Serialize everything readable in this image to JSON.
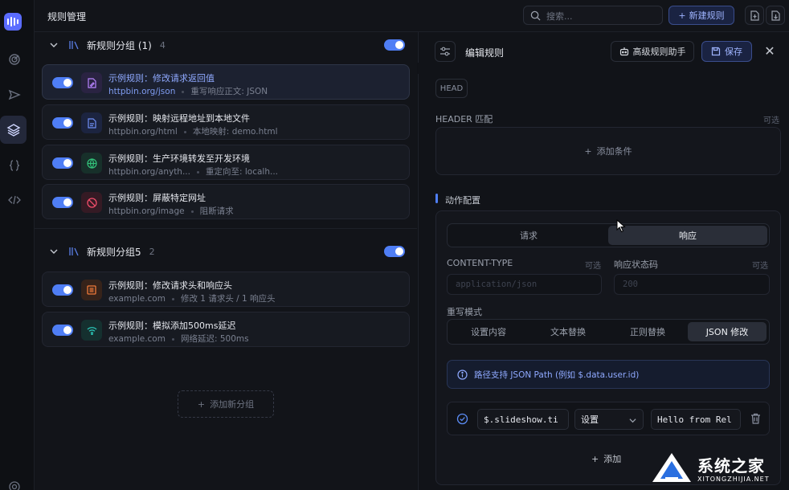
{
  "app": {
    "title": "规则管理"
  },
  "topbar": {
    "search_placeholder": "搜索...",
    "new_rule_label": "新建规则"
  },
  "groups": [
    {
      "title": "新规则分组 (1)",
      "count": "4",
      "enabled": true,
      "rules": [
        {
          "name": "示例规则：修改请求返回值",
          "host": "httpbin.org/json",
          "desc": "重写响应正文: JSON",
          "enabled": true,
          "icon": "edit-file-icon",
          "selected": true
        },
        {
          "name": "示例规则：映射远程地址到本地文件",
          "host": "httpbin.org/html",
          "desc": "本地映射: demo.html",
          "enabled": true,
          "icon": "file-icon"
        },
        {
          "name": "示例规则：生产环境转发至开发环境",
          "host": "httpbin.org/anyth...",
          "desc": "重定向至: localh...",
          "enabled": true,
          "icon": "globe-icon"
        },
        {
          "name": "示例规则：屏蔽特定网址",
          "host": "httpbin.org/image",
          "desc": "阻断请求",
          "enabled": true,
          "icon": "block-icon"
        }
      ]
    },
    {
      "title": "新规则分组5",
      "count": "2",
      "enabled": true,
      "rules": [
        {
          "name": "示例规则：修改请求头和响应头",
          "host": "example.com",
          "desc": "修改 1 请求头 / 1 响应头",
          "enabled": true,
          "icon": "list-icon"
        },
        {
          "name": "示例规则：模拟添加500ms延迟",
          "host": "example.com",
          "desc": "网络延迟: 500ms",
          "enabled": true,
          "icon": "wifi-icon"
        }
      ]
    }
  ],
  "list": {
    "add_group_label": "添加新分组"
  },
  "editor": {
    "title": "编辑规则",
    "assist_label": "高级规则助手",
    "save_label": "保存",
    "method_chip": "HEAD",
    "header_match_label": "HEADER 匹配",
    "optional_label": "可选",
    "add_condition_label": "添加条件",
    "action_config_label": "动作配置",
    "tabs": [
      {
        "label": "请求"
      },
      {
        "label": "响应",
        "active": true
      }
    ],
    "content_type_label": "CONTENT-TYPE",
    "content_type_placeholder": "application/json",
    "status_code_label": "响应状态码",
    "status_code_placeholder": "200",
    "rewrite_mode_label": "重写模式",
    "modes": [
      {
        "label": "设置内容"
      },
      {
        "label": "文本替换"
      },
      {
        "label": "正则替换"
      },
      {
        "label": "JSON 修改",
        "active": true
      }
    ],
    "info_text": "路径支持 JSON Path (例如 $.data.user.id)",
    "json_rule": {
      "path": "$.slideshow.ti",
      "op": "设置",
      "value": "Hello from Rel"
    },
    "add_label": "添加"
  },
  "watermark": {
    "text": "系统之家",
    "sub": "XITONGZHIJIA.NET"
  },
  "colors": {
    "accent": "#4f7ef5",
    "brand": "#5b6cff",
    "background": "#101217"
  }
}
